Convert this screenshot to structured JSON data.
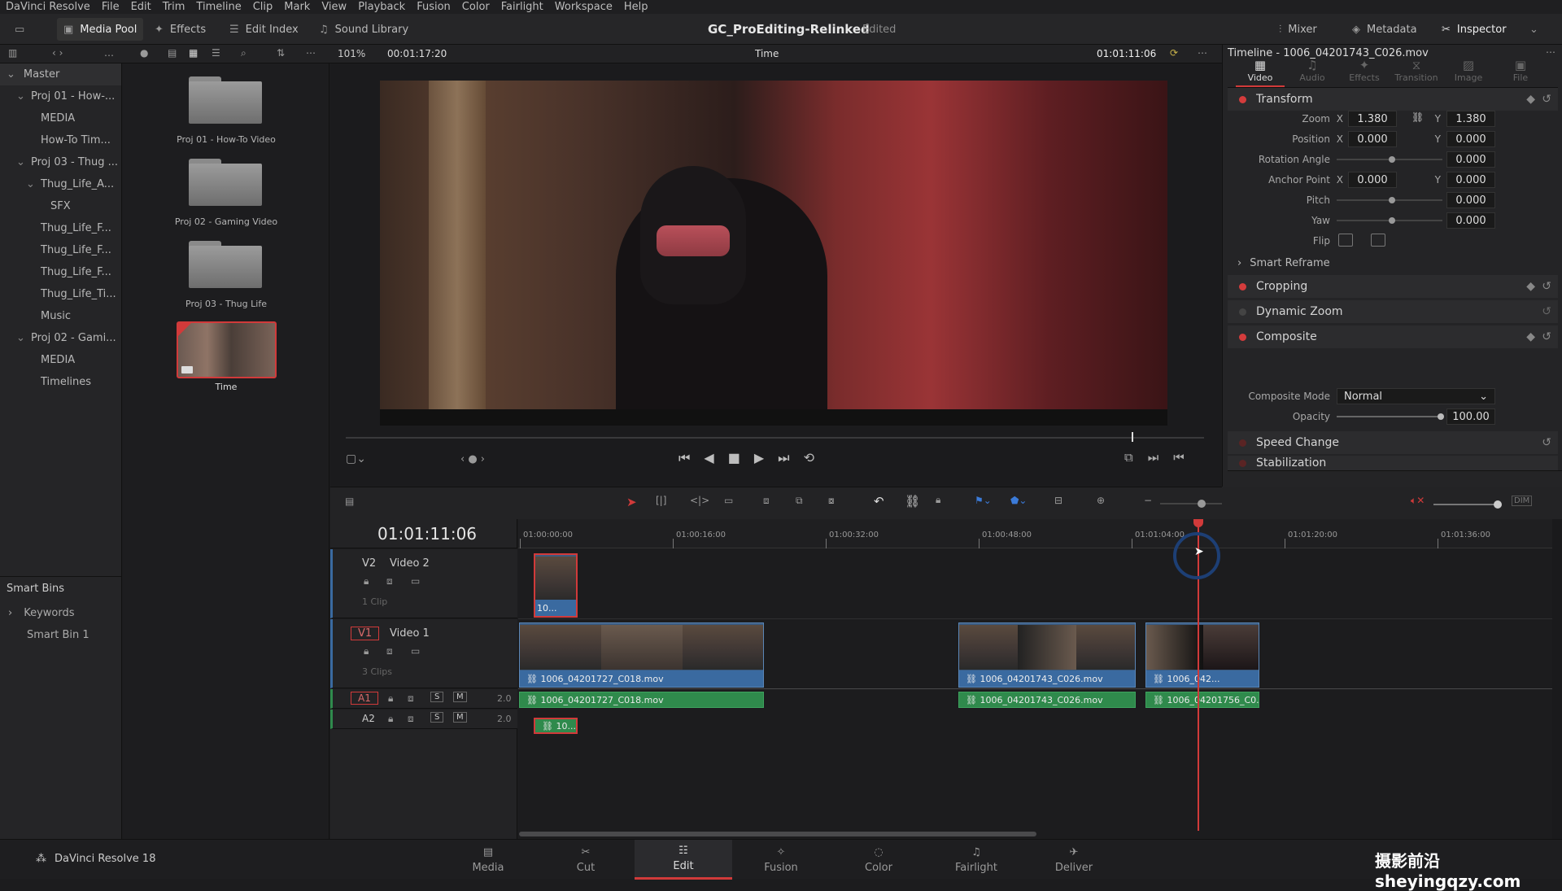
{
  "menu": [
    "DaVinci Resolve",
    "File",
    "Edit",
    "Trim",
    "Timeline",
    "Clip",
    "Mark",
    "View",
    "Playback",
    "Fusion",
    "Color",
    "Fairlight",
    "Workspace",
    "Help"
  ],
  "toolbar": {
    "media_pool": "Media Pool",
    "effects": "Effects",
    "edit_index": "Edit Index",
    "sound_library": "Sound Library",
    "project_title": "GC_ProEditing-Relinked",
    "project_status": "Edited",
    "mixer": "Mixer",
    "metadata": "Metadata",
    "inspector": "Inspector"
  },
  "viewer_bar": {
    "zoom": "101%",
    "duration": "00:01:17:20",
    "timeline_name": "Time",
    "timecode": "01:01:11:06",
    "inspector_title": "Timeline - 1006_04201743_C026.mov"
  },
  "bins": {
    "master": "Master",
    "items": [
      {
        "label": "Proj 01 - How-...",
        "indent": 1,
        "arrow": "v"
      },
      {
        "label": "MEDIA",
        "indent": 2,
        "arrow": ""
      },
      {
        "label": "How-To Tim...",
        "indent": 2,
        "arrow": ""
      },
      {
        "label": "Proj 03 - Thug ...",
        "indent": 1,
        "arrow": "v"
      },
      {
        "label": "Thug_Life_A...",
        "indent": 2,
        "arrow": "v"
      },
      {
        "label": "SFX",
        "indent": 3,
        "arrow": ""
      },
      {
        "label": "Thug_Life_F...",
        "indent": 2,
        "arrow": ""
      },
      {
        "label": "Thug_Life_F...",
        "indent": 2,
        "arrow": ""
      },
      {
        "label": "Thug_Life_F...",
        "indent": 2,
        "arrow": ""
      },
      {
        "label": "Thug_Life_Ti...",
        "indent": 2,
        "arrow": ""
      },
      {
        "label": "Music",
        "indent": 2,
        "arrow": ""
      },
      {
        "label": "Proj 02 - Gami...",
        "indent": 1,
        "arrow": "v"
      },
      {
        "label": "MEDIA",
        "indent": 2,
        "arrow": ""
      },
      {
        "label": "Timelines",
        "indent": 2,
        "arrow": ""
      }
    ],
    "smart_bins": "Smart Bins",
    "keywords": "Keywords",
    "smart_bin_1": "Smart Bin 1"
  },
  "pool": {
    "folders": [
      "Proj 01 - How-To Video",
      "Proj 02 - Gaming Video",
      "Proj 03 - Thug Life"
    ],
    "timeline_clip": "Time"
  },
  "inspector": {
    "tabs": [
      "Video",
      "Audio",
      "Effects",
      "Transition",
      "Image",
      "File"
    ],
    "transform": "Transform",
    "zoom_label": "Zoom",
    "zoom_x": "1.380",
    "zoom_y": "1.380",
    "position_label": "Position",
    "position_x": "0.000",
    "position_y": "0.000",
    "rotation_label": "Rotation Angle",
    "rotation": "0.000",
    "anchor_label": "Anchor Point",
    "anchor_x": "0.000",
    "anchor_y": "0.000",
    "pitch_label": "Pitch",
    "pitch": "0.000",
    "yaw_label": "Yaw",
    "yaw": "0.000",
    "flip_label": "Flip",
    "x": "X",
    "y": "Y",
    "smart_reframe": "Smart Reframe",
    "cropping": "Cropping",
    "dynamic_zoom": "Dynamic Zoom",
    "composite": "Composite",
    "composite_mode_label": "Composite Mode",
    "composite_mode": "Normal",
    "opacity_label": "Opacity",
    "opacity": "100.00",
    "speed_change": "Speed Change",
    "stabilization": "Stabilization"
  },
  "timeline": {
    "timecode": "01:01:11:06",
    "ruler": [
      "01:00:00:00",
      "01:00:16:00",
      "01:00:32:00",
      "01:00:48:00",
      "01:01:04:00",
      "01:01:20:00",
      "01:01:36:00"
    ],
    "v2": {
      "id": "V2",
      "name": "Video 2",
      "clips": "1 Clip"
    },
    "v1": {
      "id": "V1",
      "name": "Video 1",
      "clips": "3 Clips"
    },
    "a1": {
      "id": "A1",
      "level": "2.0"
    },
    "a2": {
      "id": "A2",
      "level": "2.0"
    },
    "s": "S",
    "m": "M",
    "v2_clip": "10...",
    "v1_clips": [
      "1006_04201727_C018.mov",
      "1006_04201743_C026.mov",
      "1006_042..."
    ],
    "a1_clips": [
      "1006_04201727_C018.mov",
      "1006_04201743_C026.mov",
      "1006_04201756_C0..."
    ],
    "a2_clip": "10...",
    "dim": "DIM"
  },
  "pages": [
    "Media",
    "Cut",
    "Edit",
    "Fusion",
    "Color",
    "Fairlight",
    "Deliver"
  ],
  "app_name": "DaVinci Resolve 18",
  "watermark": "摄影前沿 sheyingqzy.com",
  "colors": {
    "accent": "#d13a3a",
    "video_clip": "#3b5b80",
    "audio_clip": "#2f8a4c"
  }
}
